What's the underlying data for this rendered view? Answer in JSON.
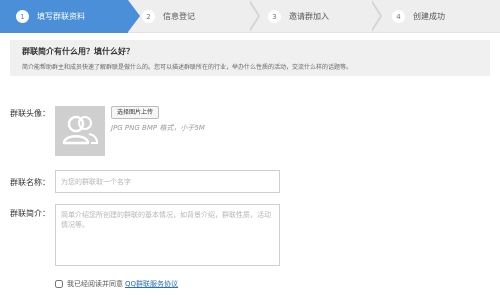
{
  "steps": [
    {
      "num": "1",
      "label": "填写群联资料"
    },
    {
      "num": "2",
      "label": "信息登记"
    },
    {
      "num": "3",
      "label": "邀请群加入"
    },
    {
      "num": "4",
      "label": "创建成功"
    }
  ],
  "intro": {
    "question": "群联简介有什么用？填什么好？",
    "description": "简介能帮助群主和成员快速了解群联是做什么的。您可以描述群联所在的行业，举办什么性质的活动，交流什么样的话题等。"
  },
  "form": {
    "avatar_label": "群联头像：",
    "upload_button": "选择图片上传",
    "format_hint": "JPG PNG BMP 格式，小于5M",
    "name_label": "群联名称：",
    "name_placeholder": "为您的群联取一个名字",
    "intro_label": "群联简介：",
    "intro_placeholder": "简单介绍您所创建的群联的基本情况，如背景介绍，群联性质，活动情况等。",
    "agree_text": "我已经阅读并同意",
    "agree_link": "QQ群联服务协议"
  },
  "colors": {
    "active_step": "#4a8fd8",
    "link": "#2a6ebd"
  },
  "icons": {
    "avatar": "people-icon"
  }
}
